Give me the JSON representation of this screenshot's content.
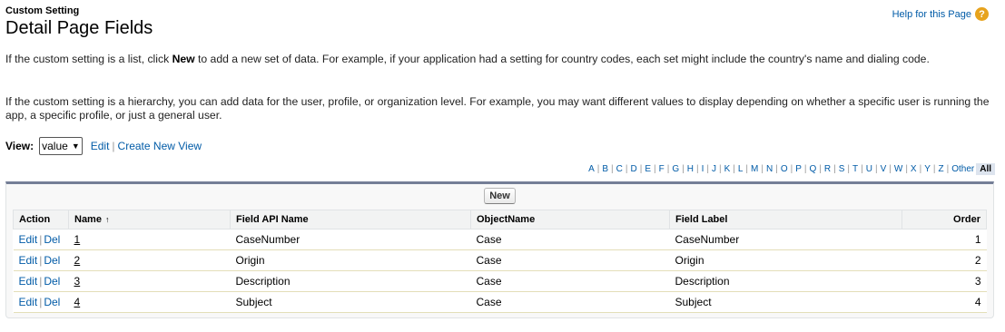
{
  "header": {
    "subtitle": "Custom Setting",
    "title": "Detail Page Fields",
    "help_link": "Help for this Page",
    "help_icon": "?"
  },
  "description": {
    "p1_a": "If the custom setting is a list, click ",
    "p1_b": "New",
    "p1_c": " to add a new set of data. For example, if your application had a setting for country codes, each set might include the country's name and dialing code.",
    "p2": "If the custom setting is a hierarchy, you can add data for the user, profile, or organization level. For example, you may want different values to display depending on whether a specific user is running the app, a specific profile, or just a general user."
  },
  "view": {
    "label": "View:",
    "selected": "value",
    "edit_link": "Edit",
    "create_link": "Create New View"
  },
  "alpha": [
    "A",
    "B",
    "C",
    "D",
    "E",
    "F",
    "G",
    "H",
    "I",
    "J",
    "K",
    "L",
    "M",
    "N",
    "O",
    "P",
    "Q",
    "R",
    "S",
    "T",
    "U",
    "V",
    "W",
    "X",
    "Y",
    "Z",
    "Other"
  ],
  "alpha_all": "All",
  "table": {
    "new_button": "New",
    "headers": {
      "action": "Action",
      "name": "Name",
      "sort_icon": "↑",
      "field_api": "Field API Name",
      "object": "ObjectName",
      "label": "Field Label",
      "order": "Order"
    },
    "edit": "Edit",
    "del": "Del",
    "rows": [
      {
        "name": "1",
        "field_api": "CaseNumber",
        "object": "Case",
        "label": "CaseNumber",
        "order": "1"
      },
      {
        "name": "2",
        "field_api": "Origin",
        "object": "Case",
        "label": "Origin",
        "order": "2"
      },
      {
        "name": "3",
        "field_api": "Description",
        "object": "Case",
        "label": "Description",
        "order": "3"
      },
      {
        "name": "4",
        "field_api": "Subject",
        "object": "Case",
        "label": "Subject",
        "order": "4"
      }
    ]
  },
  "colors": {
    "link": "#015ba7",
    "panel_border": "#747e96",
    "help_icon": "#e7a31d"
  }
}
